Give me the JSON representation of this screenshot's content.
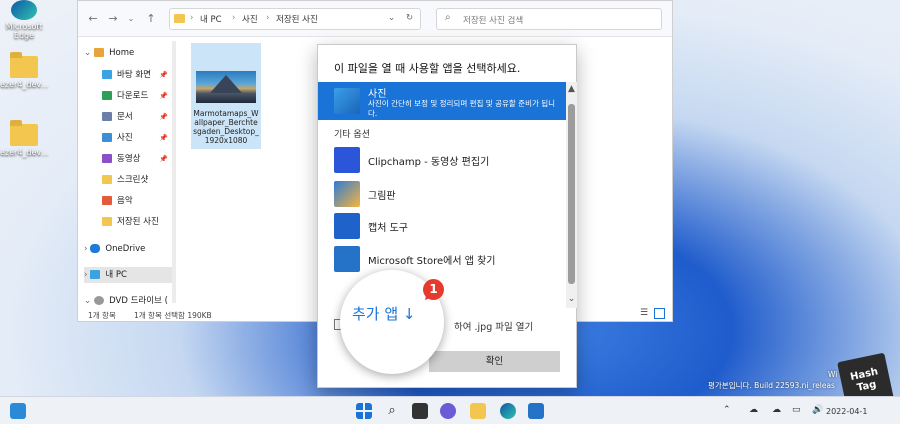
{
  "desktop": {
    "icons": [
      {
        "label": "Microsoft Edge"
      },
      {
        "label": "ezer4_dev..."
      },
      {
        "label": "ezer4_dev..."
      }
    ]
  },
  "explorer": {
    "breadcrumb": [
      "내 PC",
      "사진",
      "저장된 사진"
    ],
    "search_placeholder": "저장된 사진 검색",
    "sidebar": [
      {
        "label": "Home"
      },
      {
        "label": "바탕 화면"
      },
      {
        "label": "다운로드"
      },
      {
        "label": "문서"
      },
      {
        "label": "사진"
      },
      {
        "label": "동영상"
      },
      {
        "label": "스크린샷"
      },
      {
        "label": "음악"
      },
      {
        "label": "저장된 사진"
      },
      {
        "label": "OneDrive"
      },
      {
        "label": "내 PC"
      },
      {
        "label": "DVD 드라이브 ("
      }
    ],
    "file": {
      "name": "Marmotamaps_Wallpaper_Berchtesgaden_Desktop_1920x1080"
    },
    "status": {
      "count": "1개 항목",
      "selected": "1개 항목 선택함 190KB"
    }
  },
  "dialog": {
    "title": "이 파일을 열 때 사용할 앱을 선택하세요.",
    "selected_app": {
      "name": "사진",
      "desc": "사진이 간단히 보정 및 정리되며 편집 및 공유할 준비가 됩니다."
    },
    "other_label": "기타 옵션",
    "apps": [
      {
        "name": "Clipchamp - 동영상 편집기"
      },
      {
        "name": "그림판"
      },
      {
        "name": "캡처 도구"
      },
      {
        "name": "Microsoft Store에서 앱 찾기"
      }
    ],
    "always_text": "하여 .jpg 파일 열기",
    "ok_label": "확인"
  },
  "callout": {
    "more_apps": "추가 앱 ↓",
    "badge": "1"
  },
  "taskbar": {
    "icons": [
      "widgets-icon",
      "start-icon",
      "search-icon",
      "taskview-icon",
      "chat-icon",
      "explorer-icon",
      "edge-icon",
      "store-icon"
    ]
  },
  "watermark": {
    "line1": "Wi",
    "line2": "평가본입니다. Build 22593.ni_releas",
    "date": "2022-04-1"
  },
  "hashtag": {
    "line1": "Hash",
    "line2": "Tag"
  },
  "colors": {
    "accent": "#1a73d6",
    "badge": "#e53a2d"
  }
}
